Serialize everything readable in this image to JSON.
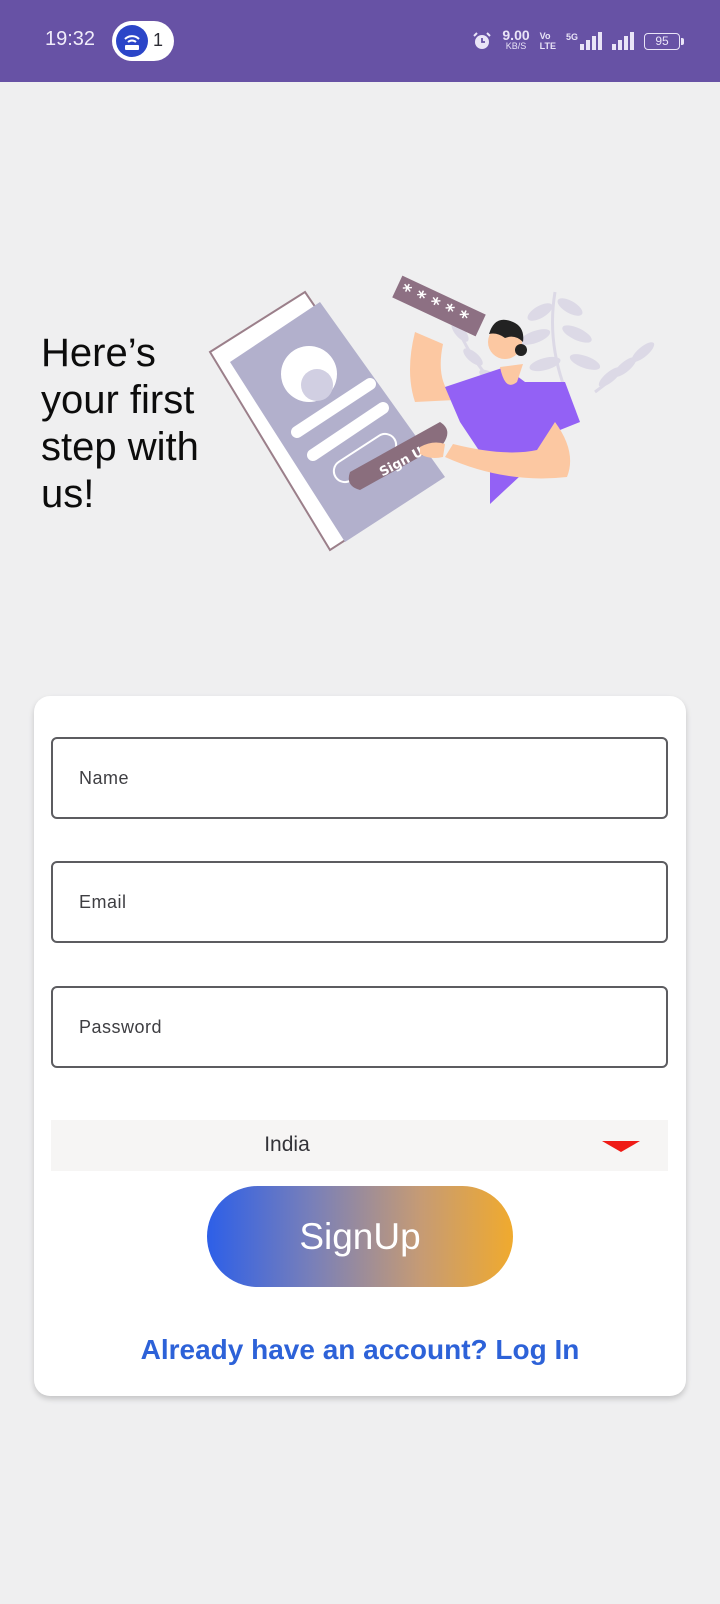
{
  "status_bar": {
    "time": "19:32",
    "hotspot_count": "1",
    "speed_value": "9.00",
    "speed_unit": "KB/S",
    "volte_top": "Vo",
    "volte_bottom": "LTE",
    "network": "5G",
    "battery": "95"
  },
  "hero": {
    "heading": "Here’s your first step with us!",
    "illustration": {
      "icons": [
        "profile-card-icon",
        "password-stars-icon",
        "person-icon",
        "plant-icon"
      ],
      "password_mask": "* * * * *",
      "button_text": "Sign Up"
    }
  },
  "form": {
    "name_placeholder": "Name",
    "email_placeholder": "Email",
    "password_placeholder": "Password",
    "country_selected": "India",
    "signup_label": "SignUp",
    "login_link": "Already have an account? Log In"
  },
  "colors": {
    "status_bar": "#6752a5",
    "background": "#efeff0",
    "link": "#2d62d8",
    "dropdown_arrow": "#ef1b16",
    "gradient_start": "#2d5fe8",
    "gradient_end": "#f0aa2e"
  }
}
